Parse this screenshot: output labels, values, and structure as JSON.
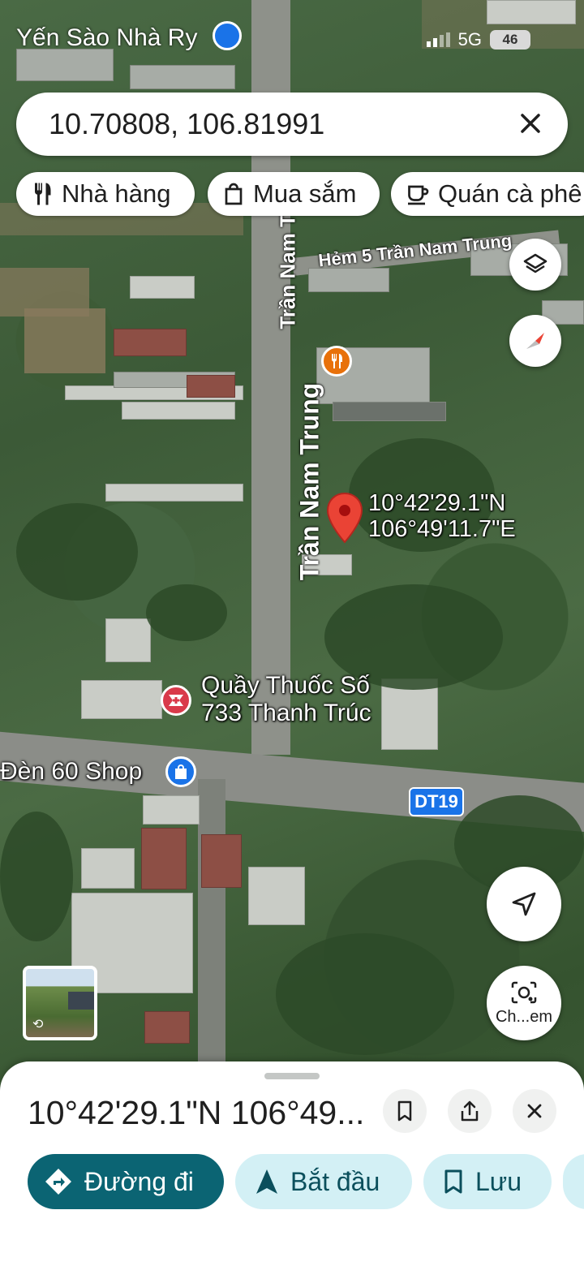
{
  "status_bar": {
    "left_text": "Yến Sào Nhà Ry",
    "network": "5G",
    "battery": "46"
  },
  "search": {
    "query": "10.70808, 106.81991"
  },
  "chips": [
    {
      "label": "Nhà hàng",
      "icon": "fork-knife-icon"
    },
    {
      "label": "Mua sắm",
      "icon": "shopping-bag-icon"
    },
    {
      "label": "Quán cà phê",
      "icon": "coffee-cup-icon"
    }
  ],
  "map": {
    "streets": {
      "main": "Trần Nam Trung",
      "main_upper": "Trần Nam Tr",
      "alley": "Hẻm 5 Trần Nam Trung",
      "route_badge": "DT19"
    },
    "pin": {
      "lat": "10°42'29.1\"N",
      "lng": "106°49'11.7\"E",
      "color": "#ea4335"
    },
    "pois": [
      {
        "name_line1": "Quầy Thuốc Số",
        "name_line2": "733 Thanh Trúc",
        "icon": "pharmacy-icon",
        "color": "#d93a4a"
      },
      {
        "name": "Đèn 60 Shop",
        "icon": "shopping-bag-icon",
        "color": "#1a73e8"
      },
      {
        "icon": "fork-knife-icon",
        "color": "#e8710a"
      }
    ],
    "lens_label": "Ch...em"
  },
  "sheet": {
    "title": "10°42'29.1\"N 106°49...",
    "actions": {
      "directions": "Đường đi",
      "start": "Bắt đầu",
      "save": "Lưu"
    },
    "colors": {
      "primary": "#0b6473",
      "tonal": "#d3f0f5"
    }
  }
}
